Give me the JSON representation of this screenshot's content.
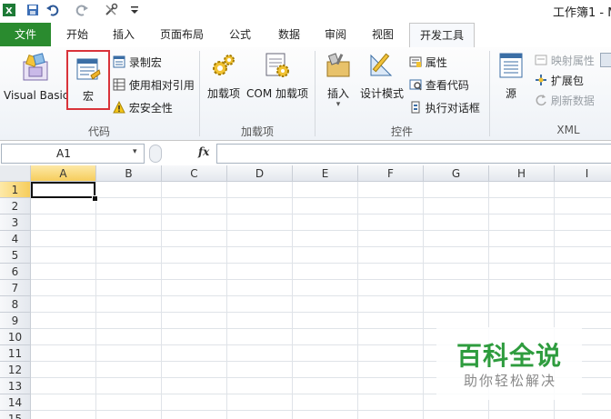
{
  "qat": {
    "icons": [
      "excel-icon",
      "save-icon",
      "undo-icon",
      "redo-icon",
      "tools-icon",
      "customize-icon"
    ]
  },
  "window": {
    "title": "工作簿1 - M"
  },
  "tabs": [
    {
      "label": "文件",
      "state": "file"
    },
    {
      "label": "开始"
    },
    {
      "label": "插入"
    },
    {
      "label": "页面布局"
    },
    {
      "label": "公式"
    },
    {
      "label": "数据"
    },
    {
      "label": "审阅"
    },
    {
      "label": "视图"
    },
    {
      "label": "开发工具",
      "state": "active"
    }
  ],
  "ribbon": {
    "code": {
      "label": "代码",
      "visual_basic": "Visual Basic",
      "macros": "宏",
      "record_macro": "录制宏",
      "relative_ref": "使用相对引用",
      "macro_security": "宏安全性"
    },
    "addins": {
      "label": "加载项",
      "addins_btn": "加载项",
      "com_addins": "COM 加载项"
    },
    "controls": {
      "label": "控件",
      "insert": "插入",
      "design_mode": "设计模式",
      "properties": "属性",
      "view_code": "查看代码",
      "run_dialog": "执行对话框"
    },
    "xml": {
      "label": "XML",
      "source": "源",
      "map_props": "映射属性",
      "expansion": "扩展包",
      "refresh": "刷新数据"
    }
  },
  "formula_bar": {
    "name_box": "A1",
    "fx": "fx",
    "value": ""
  },
  "sheet": {
    "columns": [
      "A",
      "B",
      "C",
      "D",
      "E",
      "F",
      "G",
      "H",
      "I"
    ],
    "rows": [
      "1",
      "2",
      "3",
      "4",
      "5",
      "6",
      "7",
      "8",
      "9",
      "10",
      "11",
      "12",
      "13",
      "14",
      "15"
    ],
    "selected_cell": "A1"
  },
  "watermark": {
    "title": "百科全说",
    "subtitle": "助你轻松解决"
  },
  "colors": {
    "file_tab": "#2a8b2f",
    "highlight": "#d9333a",
    "watermark": "#2e9c3e"
  }
}
